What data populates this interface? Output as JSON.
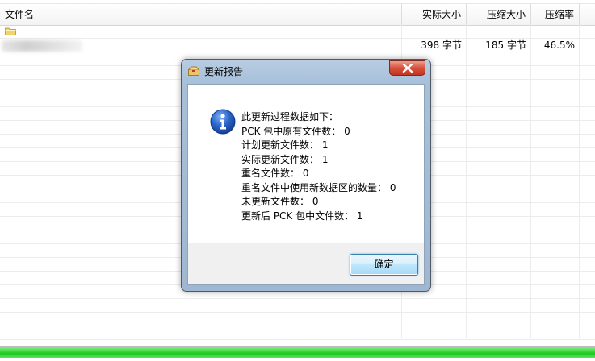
{
  "listview": {
    "columns": {
      "name": "文件名",
      "actual_size": "实际大小",
      "compressed_size": "压缩大小",
      "ratio": "压缩率"
    },
    "rows": [
      {
        "actual_size": "398 字节",
        "compressed_size": "185 字节",
        "ratio": "46.5%"
      }
    ]
  },
  "progress": {
    "fraction": 1.0,
    "color": "#2fd42f"
  },
  "dialog": {
    "title": "更新报告",
    "lines": [
      "此更新过程数据如下：",
      "PCK 包中原有文件数： 0",
      "计划更新文件数： 1",
      "实际更新文件数： 1",
      "重名文件数： 0",
      "重名文件中使用新数据区的数量： 0",
      "未更新文件数： 0",
      "更新后 PCK 包中文件数： 1"
    ],
    "ok_label": "确定",
    "icons": {
      "title": "package-icon",
      "message": "info-icon",
      "close": "close-icon"
    }
  }
}
